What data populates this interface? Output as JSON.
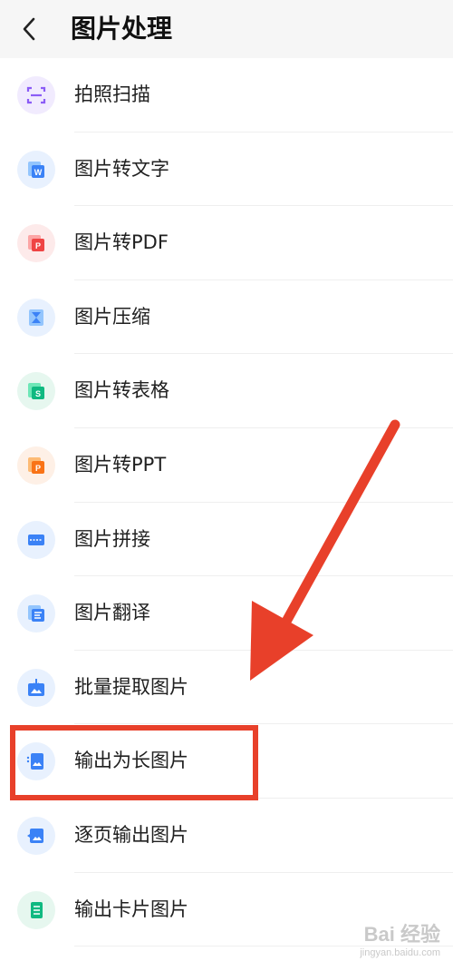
{
  "header": {
    "title": "图片处理"
  },
  "items": [
    {
      "label": "拍照扫描",
      "icon": "scan-icon",
      "color": "#8b5cf6"
    },
    {
      "label": "图片转文字",
      "icon": "image-to-word-icon",
      "color": "#3b82f6"
    },
    {
      "label": "图片转PDF",
      "icon": "image-to-pdf-icon",
      "color": "#ef4444"
    },
    {
      "label": "图片压缩",
      "icon": "compress-icon",
      "color": "#3b82f6"
    },
    {
      "label": "图片转表格",
      "icon": "image-to-sheet-icon",
      "color": "#10b981"
    },
    {
      "label": "图片转PPT",
      "icon": "image-to-ppt-icon",
      "color": "#f97316"
    },
    {
      "label": "图片拼接",
      "icon": "stitch-icon",
      "color": "#3b82f6"
    },
    {
      "label": "图片翻译",
      "icon": "translate-icon",
      "color": "#3b82f6"
    },
    {
      "label": "批量提取图片",
      "icon": "batch-extract-icon",
      "color": "#3b82f6"
    },
    {
      "label": "输出为长图片",
      "icon": "long-image-icon",
      "color": "#3b82f6"
    },
    {
      "label": "逐页输出图片",
      "icon": "page-export-icon",
      "color": "#3b82f6"
    },
    {
      "label": "输出卡片图片",
      "icon": "card-image-icon",
      "color": "#10b981"
    }
  ],
  "highlight_color": "#e8402a",
  "watermark": {
    "main": "Bai 经验",
    "sub": "jingyan.baidu.com"
  }
}
